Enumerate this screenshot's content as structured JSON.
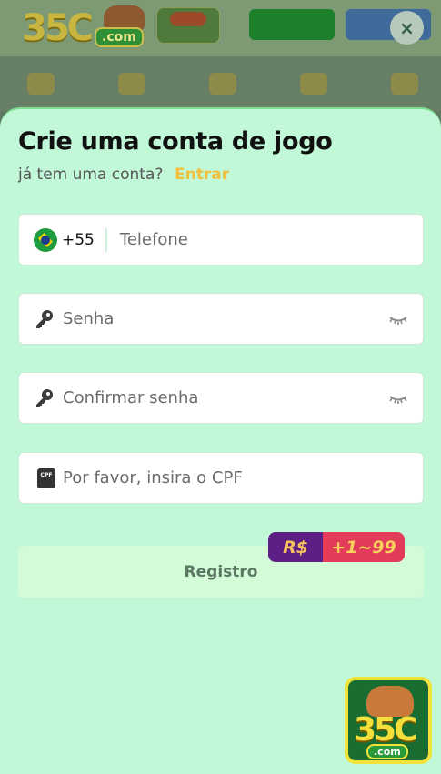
{
  "background": {
    "logo_number": "35C",
    "logo_domain": ".com"
  },
  "modal": {
    "title": "Crie uma conta de jogo",
    "subtitle": "já tem uma conta?",
    "login_link": "Entrar",
    "phone": {
      "country_code": "+55",
      "placeholder": "Telefone",
      "flag_icon": "brazil-flag-icon"
    },
    "password": {
      "placeholder": "Senha",
      "icon": "key-icon",
      "toggle_icon": "eye-closed-icon"
    },
    "confirm_password": {
      "placeholder": "Confirmar senha",
      "icon": "key-icon",
      "toggle_icon": "eye-closed-icon"
    },
    "cpf": {
      "placeholder": "Por favor, insira o CPF",
      "icon": "cpf-card-icon",
      "icon_text": "CPF"
    },
    "bonus": {
      "currency": "R$",
      "amount": "+1~99"
    },
    "register_label": "Registro",
    "close_label": "×"
  },
  "floating_logo": {
    "number": "35C",
    "domain": ".com"
  },
  "colors": {
    "sheet_bg": "#c1f8d8",
    "accent_link": "#f0c040",
    "register_bg": "#d4fbd8",
    "bonus_left": "#5d1f86",
    "bonus_right": "#e23c5a"
  }
}
